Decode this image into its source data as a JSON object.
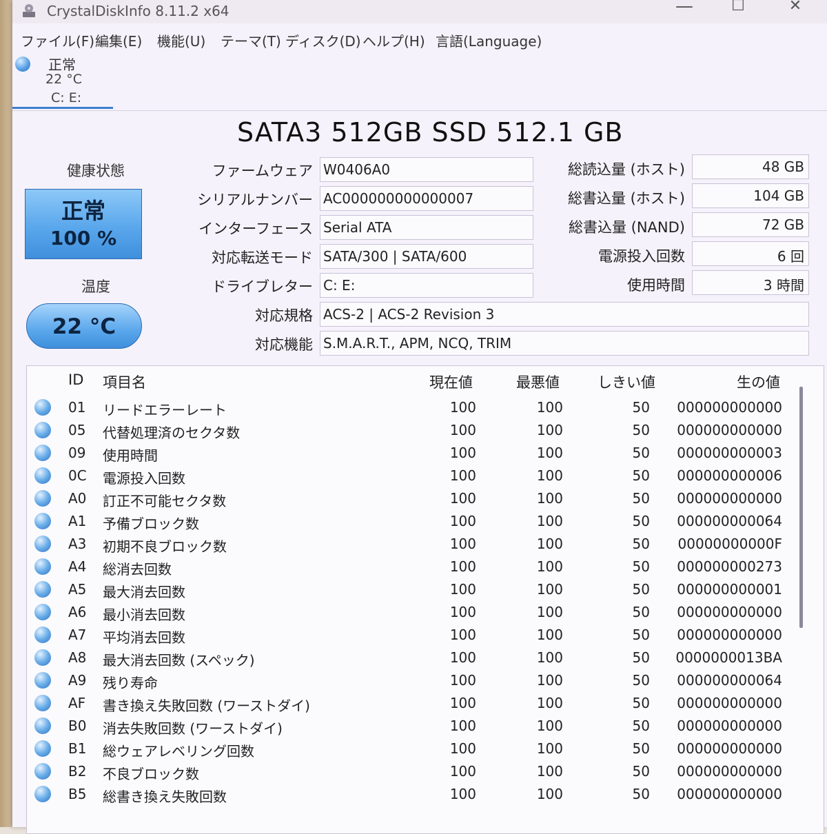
{
  "window": {
    "title": "CrystalDiskInfo 8.11.2 x64",
    "minimize": "—",
    "maximize": "☐",
    "close": "✕"
  },
  "menu": [
    {
      "label": "ファイル(F)"
    },
    {
      "label": "編集(E)"
    },
    {
      "label": "機能(U)"
    },
    {
      "label": "テーマ(T)"
    },
    {
      "label": "ディスク(D)"
    },
    {
      "label": "ヘルプ(H)"
    },
    {
      "label": "言語(Language)"
    }
  ],
  "disk_tab": {
    "status": "正常",
    "temp": "22 °C",
    "drives": "C: E:",
    "status_color": "#5aa0e6"
  },
  "disk_title": "SATA3 512GB SSD 512.1 GB",
  "health": {
    "label": "健康状態",
    "status": "正常",
    "percent": "100 %",
    "color": "#5aa7ec"
  },
  "temperature": {
    "label": "温度",
    "value": "22 °C"
  },
  "info": [
    {
      "label": "ファームウェア",
      "value": "W0406A0"
    },
    {
      "label": "シリアルナンバー",
      "value": "AC000000000000007"
    },
    {
      "label": "インターフェース",
      "value": "Serial ATA"
    },
    {
      "label": "対応転送モード",
      "value": "SATA/300 | SATA/600"
    },
    {
      "label": "ドライブレター",
      "value": "C: E:"
    },
    {
      "label": "対応規格",
      "value": "ACS-2 | ACS-2 Revision 3"
    },
    {
      "label": "対応機能",
      "value": "S.M.A.R.T., APM, NCQ, TRIM"
    }
  ],
  "stats": [
    {
      "label": "総読込量 (ホスト)",
      "value": "48 GB"
    },
    {
      "label": "総書込量 (ホスト)",
      "value": "104 GB"
    },
    {
      "label": "総書込量 (NAND)",
      "value": "72 GB"
    },
    {
      "label": "電源投入回数",
      "value": "6 回"
    },
    {
      "label": "使用時間",
      "value": "3 時間"
    }
  ],
  "smart": {
    "headers": {
      "id": "ID",
      "name": "項目名",
      "current": "現在値",
      "worst": "最悪値",
      "threshold": "しきい値",
      "raw": "生の値"
    },
    "rows": [
      {
        "id": "01",
        "name": "リードエラーレート",
        "current": "100",
        "worst": "100",
        "threshold": "50",
        "raw": "000000000000"
      },
      {
        "id": "05",
        "name": "代替処理済のセクタ数",
        "current": "100",
        "worst": "100",
        "threshold": "50",
        "raw": "000000000000"
      },
      {
        "id": "09",
        "name": "使用時間",
        "current": "100",
        "worst": "100",
        "threshold": "50",
        "raw": "000000000003"
      },
      {
        "id": "0C",
        "name": "電源投入回数",
        "current": "100",
        "worst": "100",
        "threshold": "50",
        "raw": "000000000006"
      },
      {
        "id": "A0",
        "name": "訂正不可能セクタ数",
        "current": "100",
        "worst": "100",
        "threshold": "50",
        "raw": "000000000000"
      },
      {
        "id": "A1",
        "name": "予備ブロック数",
        "current": "100",
        "worst": "100",
        "threshold": "50",
        "raw": "000000000064"
      },
      {
        "id": "A3",
        "name": "初期不良ブロック数",
        "current": "100",
        "worst": "100",
        "threshold": "50",
        "raw": "00000000000F"
      },
      {
        "id": "A4",
        "name": "総消去回数",
        "current": "100",
        "worst": "100",
        "threshold": "50",
        "raw": "000000000273"
      },
      {
        "id": "A5",
        "name": "最大消去回数",
        "current": "100",
        "worst": "100",
        "threshold": "50",
        "raw": "000000000001"
      },
      {
        "id": "A6",
        "name": "最小消去回数",
        "current": "100",
        "worst": "100",
        "threshold": "50",
        "raw": "000000000000"
      },
      {
        "id": "A7",
        "name": "平均消去回数",
        "current": "100",
        "worst": "100",
        "threshold": "50",
        "raw": "000000000000"
      },
      {
        "id": "A8",
        "name": "最大消去回数 (スペック)",
        "current": "100",
        "worst": "100",
        "threshold": "50",
        "raw": "0000000013BA"
      },
      {
        "id": "A9",
        "name": "残り寿命",
        "current": "100",
        "worst": "100",
        "threshold": "50",
        "raw": "000000000064"
      },
      {
        "id": "AF",
        "name": "書き換え失敗回数 (ワーストダイ)",
        "current": "100",
        "worst": "100",
        "threshold": "50",
        "raw": "000000000000"
      },
      {
        "id": "B0",
        "name": "消去失敗回数 (ワーストダイ)",
        "current": "100",
        "worst": "100",
        "threshold": "50",
        "raw": "000000000000"
      },
      {
        "id": "B1",
        "name": "総ウェアレベリング回数",
        "current": "100",
        "worst": "100",
        "threshold": "50",
        "raw": "000000000000"
      },
      {
        "id": "B2",
        "name": "不良ブロック数",
        "current": "100",
        "worst": "100",
        "threshold": "50",
        "raw": "000000000000"
      },
      {
        "id": "B5",
        "name": "総書き換え失敗回数",
        "current": "100",
        "worst": "100",
        "threshold": "50",
        "raw": "000000000000"
      }
    ]
  }
}
